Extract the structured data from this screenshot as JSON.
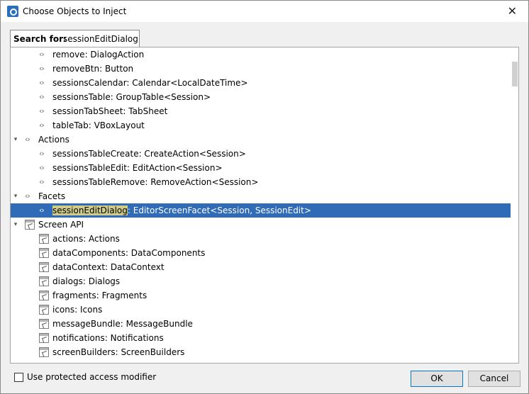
{
  "window": {
    "title": "Choose Objects to Inject",
    "close_glyph": "✕"
  },
  "search": {
    "label": "Search for:",
    "value": "sessionEditDialog"
  },
  "tree": {
    "rows": [
      {
        "kind": "field",
        "label": "remove: DialogAction"
      },
      {
        "kind": "field",
        "label": "removeBtn: Button"
      },
      {
        "kind": "field",
        "label": "sessionsCalendar: Calendar<LocalDateTime>"
      },
      {
        "kind": "field",
        "label": "sessionsTable: GroupTable<Session>"
      },
      {
        "kind": "field",
        "label": "sessionTabSheet: TabSheet"
      },
      {
        "kind": "field",
        "label": "tableTab: VBoxLayout"
      },
      {
        "kind": "group",
        "label": "Actions",
        "icon": "field"
      },
      {
        "kind": "field",
        "label": "sessionsTableCreate: CreateAction<Session>"
      },
      {
        "kind": "field",
        "label": "sessionsTableEdit: EditAction<Session>"
      },
      {
        "kind": "field",
        "label": "sessionsTableRemove: RemoveAction<Session>"
      },
      {
        "kind": "group",
        "label": "Facets",
        "icon": "field"
      },
      {
        "kind": "field",
        "selected": true,
        "highlight": "sessionEditDialog",
        "label_rest": ": EditorScreenFacet<Session, SessionEdit>"
      },
      {
        "kind": "group",
        "label": "Screen API",
        "icon": "api"
      },
      {
        "kind": "api",
        "label": "actions: Actions"
      },
      {
        "kind": "api",
        "label": "dataComponents: DataComponents"
      },
      {
        "kind": "api",
        "label": "dataContext: DataContext"
      },
      {
        "kind": "api",
        "label": "dialogs: Dialogs"
      },
      {
        "kind": "api",
        "label": "fragments: Fragments"
      },
      {
        "kind": "api",
        "label": "icons: Icons"
      },
      {
        "kind": "api",
        "label": "messageBundle: MessageBundle"
      },
      {
        "kind": "api",
        "label": "notifications: Notifications"
      },
      {
        "kind": "api",
        "label": "screenBuilders: ScreenBuilders"
      }
    ]
  },
  "options": {
    "protected_label": "Use protected access modifier",
    "protected_checked": false
  },
  "buttons": {
    "ok": "OK",
    "cancel": "Cancel"
  },
  "icons": {
    "field": "field-icon",
    "api": "screen-api-icon",
    "expand": "chevron-down-icon"
  },
  "colors": {
    "selection": "#2f6bb6",
    "match_highlight": "#cfcc8a"
  }
}
